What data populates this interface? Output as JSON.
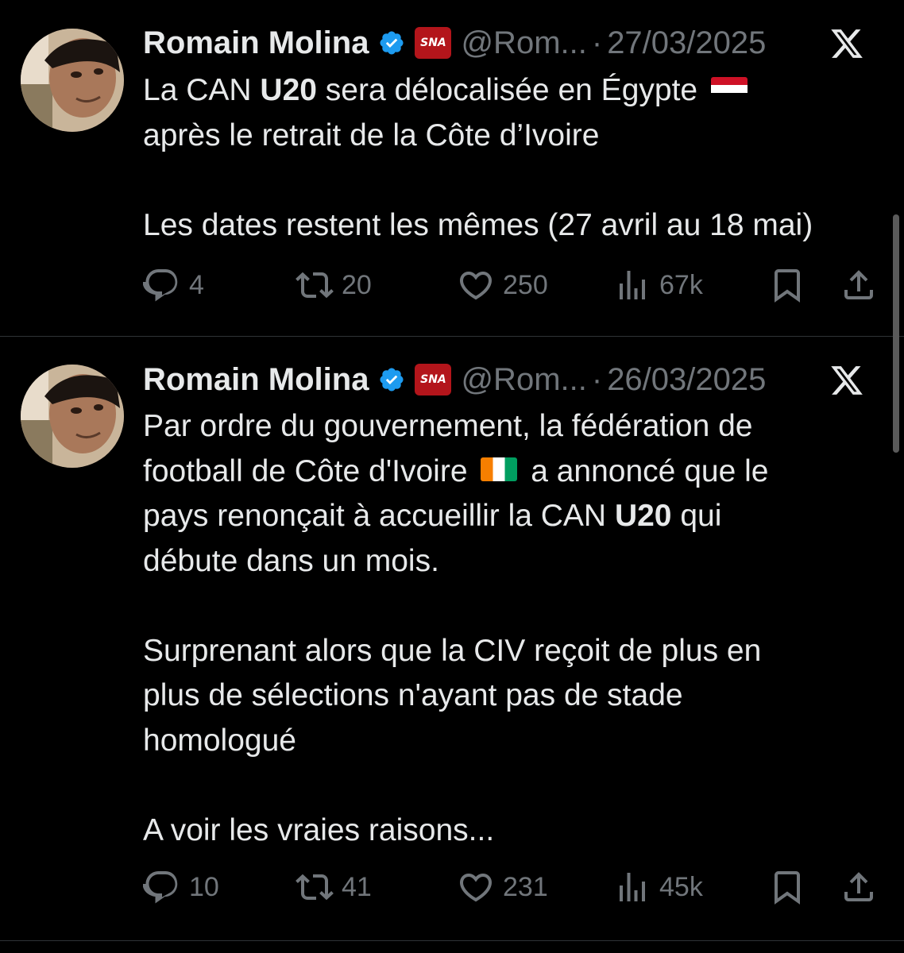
{
  "tweets": [
    {
      "author": {
        "name": "Romain Molina",
        "badge_text": "SNA",
        "handle": "@Rom...",
        "separator": "·"
      },
      "date": "27/03/2025",
      "body": {
        "p1_pre": "La CAN ",
        "p1_bold": "U20",
        "p1_mid": " sera délocalisée en Égypte ",
        "p1_post": "\naprès le retrait de la Côte d’Ivoire\n\nLes dates restent les mêmes (27 avril au 18 mai)"
      },
      "stats": {
        "replies": "4",
        "reposts": "20",
        "likes": "250",
        "views": "67k"
      }
    },
    {
      "author": {
        "name": "Romain Molina",
        "badge_text": "SNA",
        "handle": "@Rom...",
        "separator": "·"
      },
      "date": "26/03/2025",
      "body": {
        "p1_pre": "Par ordre du gouvernement, la fédération de\nfootball de Côte d'Ivoire ",
        "p1_mid": " a annoncé que le\npays renonçait à accueillir la CAN ",
        "p1_bold": "U20",
        "p1_post": " qui\ndébute dans un mois.\n\nSurprenant alors que la CIV reçoit de plus en\nplus de sélections n'ayant pas de stade\nhomologué\n\nA voir les vraies raisons..."
      },
      "stats": {
        "replies": "10",
        "reposts": "41",
        "likes": "231",
        "views": "45k"
      }
    }
  ],
  "icons": {
    "verified": "verified-badge-icon",
    "platform": "x-logo-icon",
    "reply": "reply-icon",
    "repost": "repost-icon",
    "like": "heart-icon",
    "views": "views-icon",
    "bookmark": "bookmark-icon",
    "share": "share-icon"
  },
  "colors": {
    "background": "#000000",
    "text": "#e7e9ea",
    "muted": "#71767b",
    "verified": "#1d9bf0",
    "badge": "#b3151b"
  }
}
